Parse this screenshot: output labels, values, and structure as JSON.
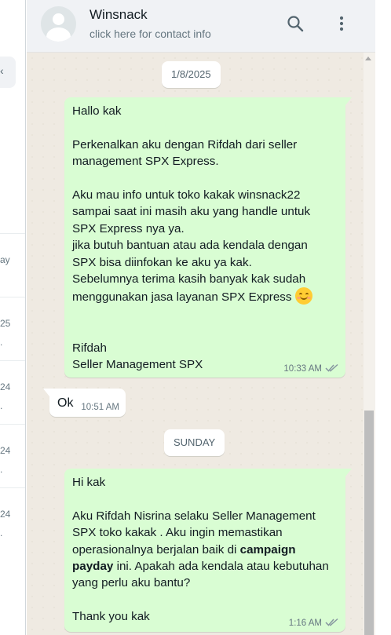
{
  "left_list": {
    "fragments": [
      {
        "text": "ay",
        "sub": ""
      },
      {
        "text": "25",
        "sub": "."
      },
      {
        "text": "24",
        "sub": "."
      },
      {
        "text": "24",
        "sub": "."
      },
      {
        "text": "24",
        "sub": "."
      }
    ]
  },
  "header": {
    "contact_name": "Winsnack",
    "contact_info": "click here for contact info"
  },
  "chat": {
    "date_1": "1/8/2025",
    "date_2": "SUNDAY",
    "message_1": {
      "lines": [
        "Hallo kak",
        "",
        "Perkenalkan aku dengan Rifdah dari seller",
        "management SPX Express.",
        "",
        "Aku mau info untuk toko kakak winsnack22",
        "sampai saat ini masih aku yang handle untuk",
        "SPX Express nya ya.",
        "jika butuh bantuan atau ada kendala dengan",
        "SPX bisa diinfokan ke aku ya kak.",
        "Sebelumnya terima kasih banyak kak sudah",
        "menggunakan jasa layanan SPX Express",
        "",
        "",
        "Rifdah",
        "Seller Management SPX"
      ],
      "time": "10:33 AM"
    },
    "message_2": {
      "text": "Ok",
      "time": "10:51 AM"
    },
    "message_3": {
      "line_1": "Hi kak",
      "line_3": "Aku Rifdah Nisrina selaku Seller Management",
      "line_4": "SPX toko kakak . Aku ingin memastikan",
      "line_5_pre": "operasionalnya berjalan baik di ",
      "line_5_bold": "campaign",
      "line_6_bold": "payday",
      "line_6_post": " ini. Apakah ada kendala atau kebutuhan",
      "line_7": "yang perlu aku bantu?",
      "line_9": "Thank you kak",
      "time": "1:16 AM"
    }
  },
  "icons": [
    "avatar-icon",
    "search-icon",
    "menu-icon",
    "double-check-icon",
    "smiling-emoji-icon"
  ],
  "colors": {
    "outgoing_bubble": "#d9fdd3",
    "incoming_bubble": "#ffffff",
    "chat_background": "#efeae2",
    "header_background": "#f0f2f5"
  }
}
